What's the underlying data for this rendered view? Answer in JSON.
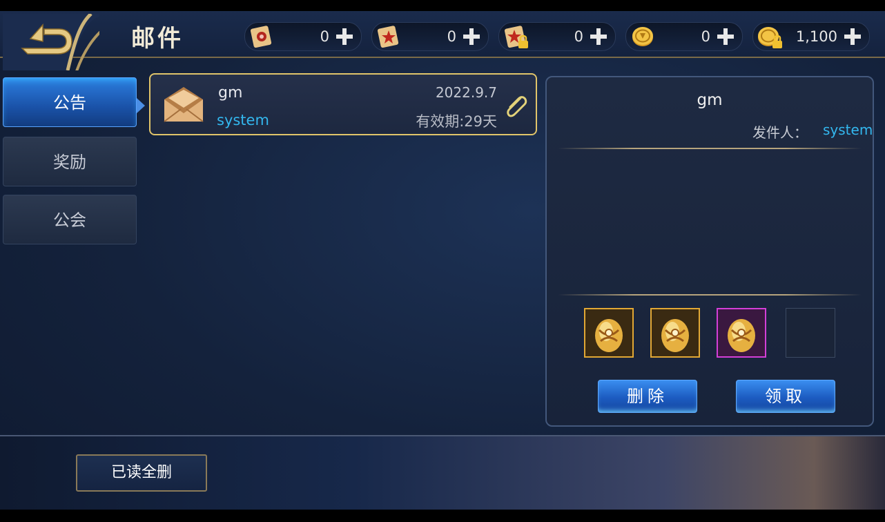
{
  "header": {
    "title": "邮件",
    "back_icon": "back-arrow-icon",
    "resources": [
      {
        "icon": "scroll-red-seal-icon",
        "value": "0"
      },
      {
        "icon": "scroll-star-icon",
        "value": "0"
      },
      {
        "icon": "scroll-locked-icon",
        "value": "0"
      },
      {
        "icon": "gold-coin-icon",
        "value": "0"
      },
      {
        "icon": "gold-coin-locked-icon",
        "value": "1,100"
      }
    ]
  },
  "tabs": [
    {
      "label": "公告",
      "active": true
    },
    {
      "label": "奖励",
      "active": false
    },
    {
      "label": "公会",
      "active": false
    }
  ],
  "mail_list": [
    {
      "subject": "gm",
      "sender": "system",
      "date": "2022.9.7",
      "expiry": "有效期:29天",
      "has_attachment": true
    }
  ],
  "detail": {
    "title": "gm",
    "from_label": "发件人：",
    "from_value": "system",
    "attachments": [
      {
        "icon": "golden-egg-icon",
        "rarity": "gold"
      },
      {
        "icon": "golden-egg-icon",
        "rarity": "gold"
      },
      {
        "icon": "golden-egg-icon",
        "rarity": "purple"
      },
      {
        "icon": "empty-slot",
        "rarity": "empty"
      }
    ],
    "delete_label": "删除",
    "claim_label": "领取"
  },
  "footer": {
    "read_delete_all_label": "已读全删"
  },
  "colors": {
    "accent_blue": "#33b7ee",
    "gold_border": "#e1c56a",
    "purple_border": "#d43fd8"
  }
}
